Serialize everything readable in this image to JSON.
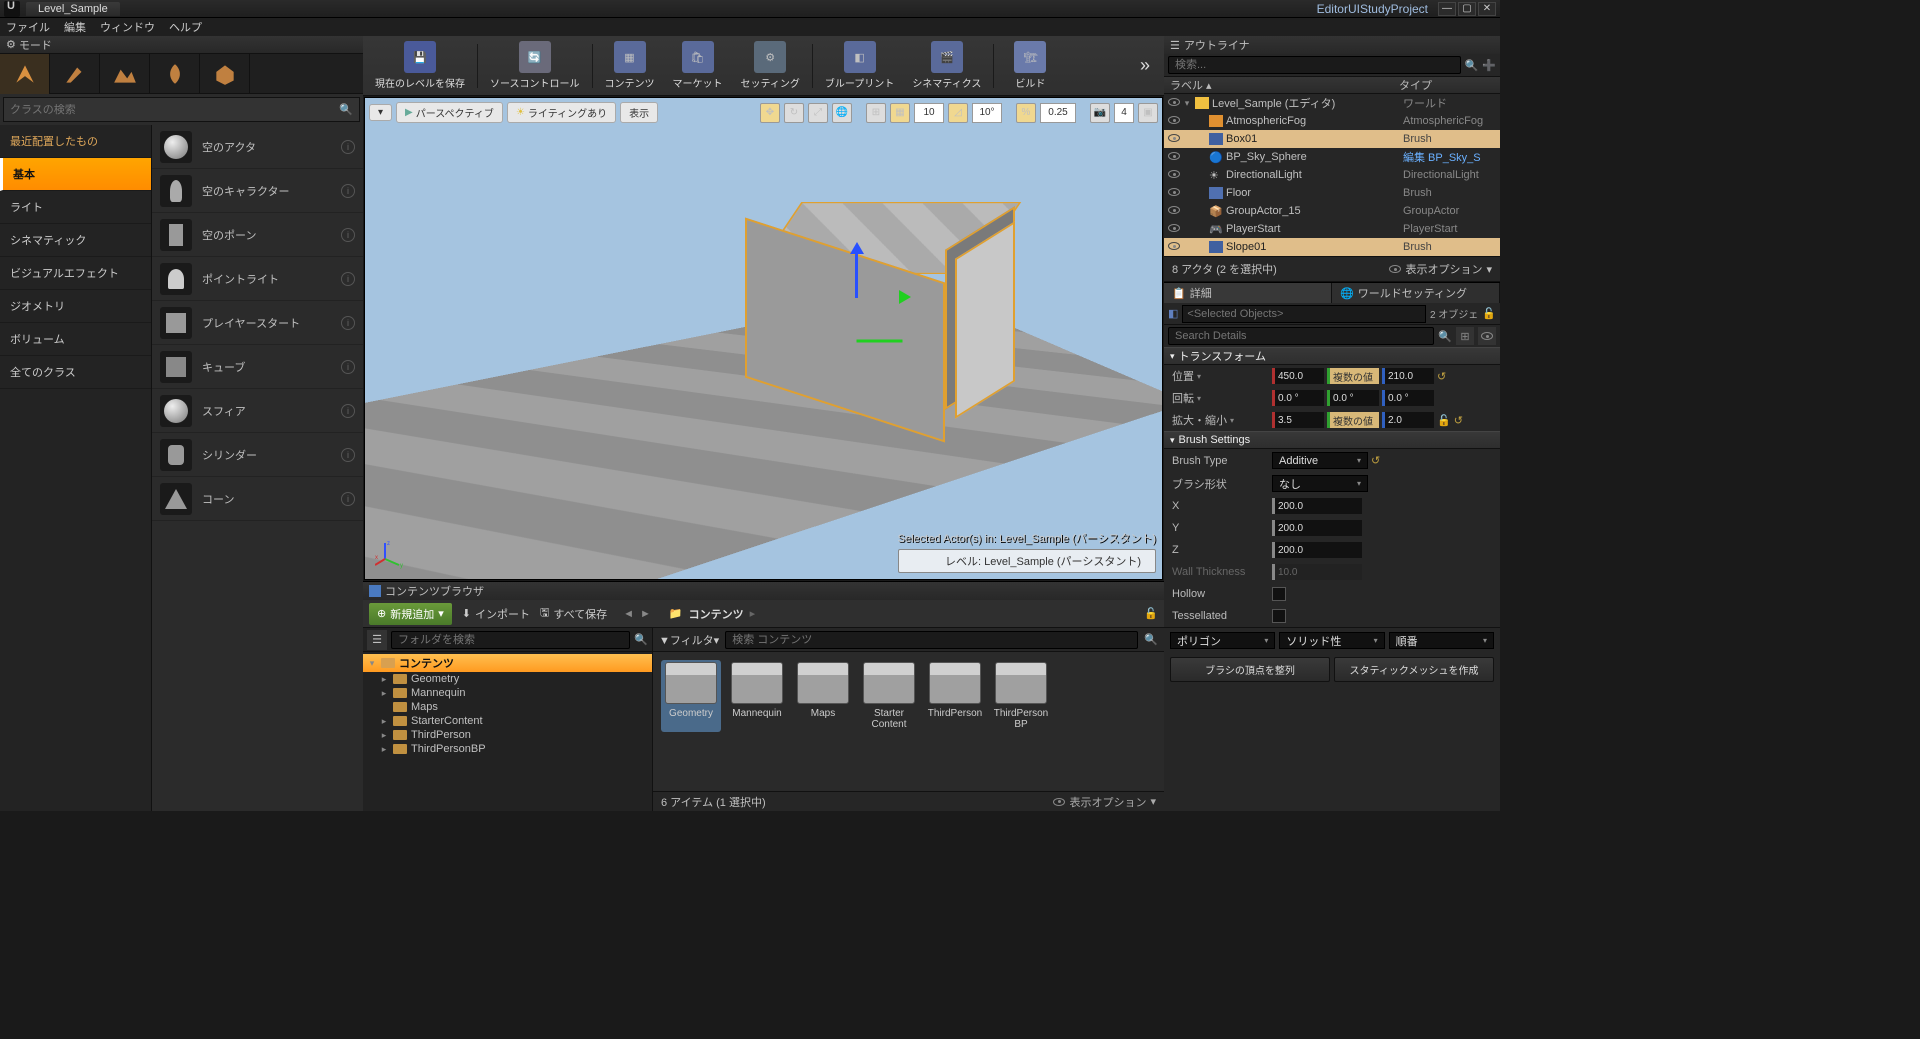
{
  "title": {
    "level_tab": "Level_Sample",
    "project": "EditorUIStudyProject"
  },
  "menubar": {
    "file": "ファイル",
    "edit": "編集",
    "window": "ウィンドウ",
    "help": "ヘルプ"
  },
  "modes": {
    "header": "モード",
    "search_placeholder": "クラスの検索",
    "categories": {
      "recent": "最近配置したもの",
      "basic": "基本",
      "lights": "ライト",
      "cinematic": "シネマティック",
      "vfx": "ビジュアルエフェクト",
      "geometry": "ジオメトリ",
      "volumes": "ボリューム",
      "all": "全てのクラス"
    },
    "assets": {
      "empty_actor": "空のアクタ",
      "empty_char": "空のキャラクター",
      "empty_pawn": "空のポーン",
      "point_light": "ポイントライト",
      "player_start": "プレイヤースタート",
      "cube": "キューブ",
      "sphere": "スフィア",
      "cylinder": "シリンダー",
      "cone": "コーン"
    }
  },
  "toolbar": {
    "save": "現在のレベルを保存",
    "source": "ソースコントロール",
    "content": "コンテンツ",
    "market": "マーケット",
    "settings": "セッティング",
    "blueprints": "ブループリント",
    "cinematics": "シネマティクス",
    "build": "ビルド"
  },
  "viewport": {
    "dropdown": "▾",
    "perspective": "パースペクティブ",
    "lit": "ライティングあり",
    "show": "表示",
    "grid_snap": "10",
    "angle_snap": "10°",
    "scale_snap": "0.25",
    "cam_speed": "4",
    "selected_actors": "Selected Actor(s) in:  Level_Sample (パーシスタント)",
    "level_label": "レベル:  Level_Sample (パーシスタント)"
  },
  "content_browser": {
    "header": "コンテンツブラウザ",
    "add_new": "新規追加",
    "import": "インポート",
    "save_all": "すべて保存",
    "path_root": "コンテンツ",
    "folder_search_placeholder": "フォルダを検索",
    "filter_label": "フィルタ",
    "content_search_placeholder": "検索 コンテンツ",
    "tree": {
      "root": "コンテンツ",
      "geometry": "Geometry",
      "mannequin": "Mannequin",
      "maps": "Maps",
      "starter": "StarterContent",
      "thirdperson": "ThirdPerson",
      "thirdpersonbp": "ThirdPersonBP"
    },
    "items": {
      "geometry": "Geometry",
      "mannequin": "Mannequin",
      "maps": "Maps",
      "starter": "Starter Content",
      "thirdperson": "ThirdPerson",
      "thirdpersonbp": "ThirdPerson BP"
    },
    "status": "6 アイテム (1 選択中)",
    "view_options": "表示オプション"
  },
  "outliner": {
    "header": "アウトライナ",
    "search_placeholder": "検索...",
    "col_label": "ラベル",
    "col_type": "タイプ",
    "rows": {
      "level": {
        "name": "Level_Sample (エディタ)",
        "type": "ワールド"
      },
      "fog": {
        "name": "AtmosphericFog",
        "type": "AtmosphericFog"
      },
      "box": {
        "name": "Box01",
        "type": "Brush"
      },
      "sky": {
        "name": "BP_Sky_Sphere",
        "type": "編集 BP_Sky_S"
      },
      "dlight": {
        "name": "DirectionalLight",
        "type": "DirectionalLight"
      },
      "floor": {
        "name": "Floor",
        "type": "Brush"
      },
      "group": {
        "name": "GroupActor_15",
        "type": "GroupActor"
      },
      "pstart": {
        "name": "PlayerStart",
        "type": "PlayerStart"
      },
      "slope": {
        "name": "Slope01",
        "type": "Brush"
      }
    },
    "footer": "8 アクタ (2 を選択中)",
    "view_options": "表示オプション"
  },
  "details": {
    "tab_details": "詳細",
    "tab_world": "ワールドセッティング",
    "selected_placeholder": "<Selected Objects>",
    "object_count": "2 オブジェ",
    "search_placeholder": "Search Details",
    "transform": {
      "header": "トランスフォーム",
      "location": "位置",
      "location_vals": {
        "x": "450.0",
        "y": "複数の値",
        "z": "210.0"
      },
      "rotation": "回転",
      "rotation_vals": {
        "x": "0.0 °",
        "y": "0.0 °",
        "z": "0.0 °"
      },
      "scale": "拡大・縮小",
      "scale_vals": {
        "x": "3.5",
        "y": "複数の値",
        "z": "2.0"
      }
    },
    "brush": {
      "header": "Brush Settings",
      "brush_type": "Brush Type",
      "brush_type_val": "Additive",
      "brush_shape": "ブラシ形状",
      "brush_shape_val": "なし",
      "x": "X",
      "x_val": "200.0",
      "y": "Y",
      "y_val": "200.0",
      "z": "Z",
      "z_val": "200.0",
      "wall": "Wall Thickness",
      "wall_val": "10.0",
      "hollow": "Hollow",
      "tess": "Tessellated"
    },
    "geom_dd1": "ポリゴン",
    "geom_dd2": "ソリッド性",
    "geom_dd3": "順番",
    "btn_align": "ブラシの頂点を整列",
    "btn_mesh": "スタティックメッシュを作成"
  }
}
